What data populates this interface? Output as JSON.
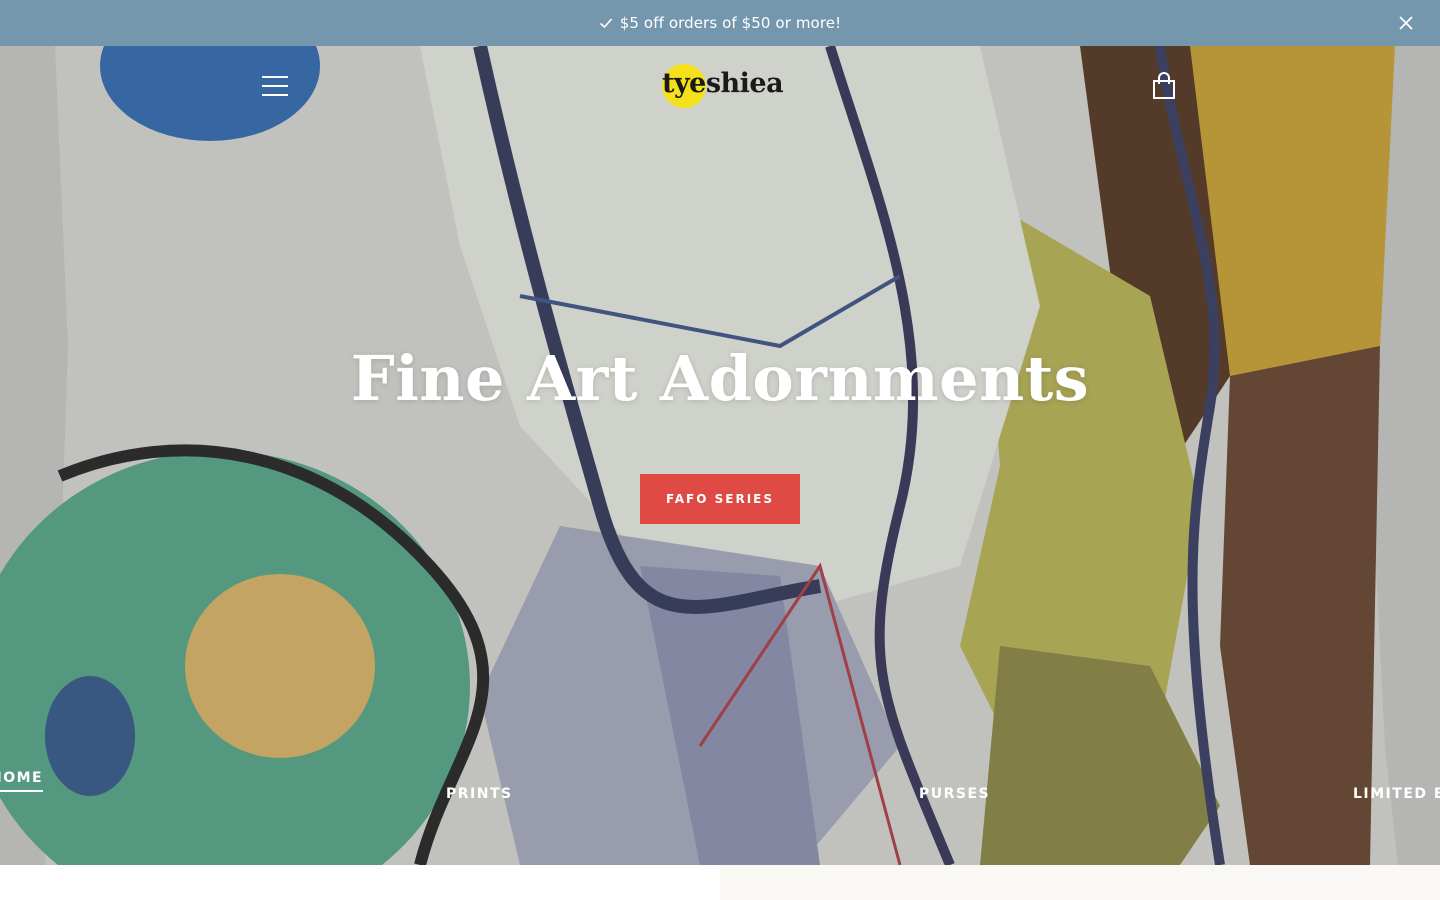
{
  "announcement": {
    "text": "$5 off orders of $50 or more!",
    "check_icon": "check-icon",
    "close_icon": "close-icon"
  },
  "header": {
    "menu_icon": "hamburger-menu-icon",
    "logo_text": "tyeshiea",
    "logo_accent": "#f5e11a",
    "cart_icon": "shopping-bag-icon"
  },
  "hero": {
    "title": "Fine Art Adornments",
    "cta_label": "FAFO SERIES",
    "cta_color": "#e04a45"
  },
  "hero_nav": {
    "items": [
      {
        "label": "HOME"
      },
      {
        "label": "PRINTS"
      },
      {
        "label": "PURSES"
      },
      {
        "label": "LIMITED EDITION"
      }
    ]
  },
  "colors": {
    "announcement_bg": "#7497ae",
    "below_right_bg": "#f9f8f4"
  }
}
